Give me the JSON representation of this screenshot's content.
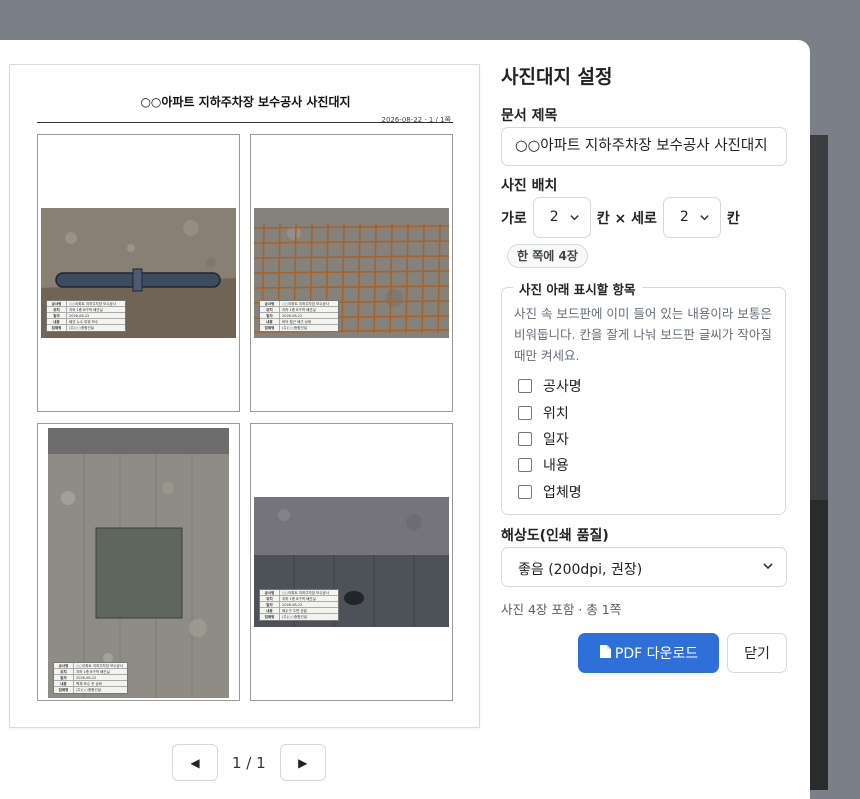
{
  "preview": {
    "title": "○○아파트 지하주차장 보수공사 사진대지",
    "meta": "2026-08-22 · 1 / 1쪽",
    "board_keys": [
      "공사명",
      "위치",
      "일자",
      "내용",
      "업체명"
    ],
    "board_values": [
      [
        "○○아파트 지하주차장 보수공사",
        "지하 1층 B구역 배관실",
        "2026-08-22",
        "배관 누수 부위 보수",
        "(주)○○종합건설"
      ],
      [
        "○○아파트 지하주차장 보수공사",
        "지하 1층 B구역 배관실",
        "2026-08-22",
        "바닥 철근 배근 상태",
        "(주)○○종합건설"
      ],
      [
        "○○아파트 지하주차장 보수공사",
        "지하 1층 B구역 배관실",
        "2026-08-22",
        "벽체 보수 전 상태",
        "(주)○○종합건설"
      ],
      [
        "○○아파트 지하주차장 보수공사",
        "지하 1층 B구역 배관실",
        "2026-08-22",
        "배수구 주변 균열",
        "(주)○○종합건설"
      ]
    ],
    "pager": {
      "text": "1 / 1",
      "prev_icon": "prev-arrow-icon",
      "next_icon": "next-arrow-icon"
    }
  },
  "settings": {
    "heading": "사진대지 설정",
    "doc_title_label": "문서 제목",
    "doc_title_value": "○○아파트 지하주차장 보수공사 사진대지",
    "layout_label": "사진 배치",
    "cols_label": "가로",
    "cols_value": "2",
    "times_label": "칸 × 세로",
    "rows_value": "2",
    "rows_unit": "칸",
    "per_page_pill": "한 쪽에 4장",
    "caption_legend": "사진 아래 표시할 항목",
    "caption_help": "사진 속 보드판에 이미 들어 있는 내용이라 보통은 비워둡니다. 칸을 잘게 나눠 보드판 글씨가 작아질 때만 켜세요.",
    "caption_items": [
      "공사명",
      "위치",
      "일자",
      "내용",
      "업체명"
    ],
    "resolution_label": "해상도(인쇄 품질)",
    "resolution_value": "좋음 (200dpi, 권장)",
    "summary": "사진 4장 포함 · 총 1쪽",
    "download_label": "PDF 다운로드",
    "download_icon": "file-icon",
    "close_label": "닫기"
  },
  "colors": {
    "primary": "#2f6fd8",
    "backdrop": "#7b8088"
  }
}
